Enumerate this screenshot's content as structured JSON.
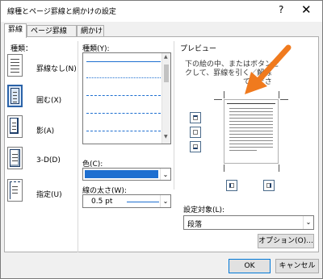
{
  "window": {
    "title": "線種とページ罫線と網かけの設定",
    "help": "?",
    "close": "✕"
  },
  "tabs": [
    {
      "label": "罫線"
    },
    {
      "label": "ページ罫線"
    },
    {
      "label": "網かけ"
    }
  ],
  "settings": {
    "header": "種類：",
    "items": [
      {
        "label": "罫線なし(N)"
      },
      {
        "label": "囲む(X)"
      },
      {
        "label": "影(A)"
      },
      {
        "label": "3-D(D)"
      },
      {
        "label": "指定(U)"
      }
    ]
  },
  "style": {
    "label": "種類(Y):",
    "samples": [
      "solid",
      "dotted",
      "dashed",
      "dashdot",
      "dashdotdot"
    ]
  },
  "color": {
    "label": "色(C):",
    "value": "",
    "swatch": "#1e6fd0"
  },
  "width": {
    "label": "線の太さ(W):",
    "value": "0.5 pt"
  },
  "preview": {
    "header": "プレビュー",
    "instruction_line1": "下の絵の中、またはボタンを",
    "instruction_line2": "クして、罫線を引く／解除",
    "instruction_line3": "てくださ",
    "arrow_color": "#f07a1e"
  },
  "apply": {
    "label": "設定対象(L):",
    "value": "段落"
  },
  "buttons": {
    "options": "オプション(O)...",
    "ok": "OK",
    "cancel": "キャンセル"
  }
}
